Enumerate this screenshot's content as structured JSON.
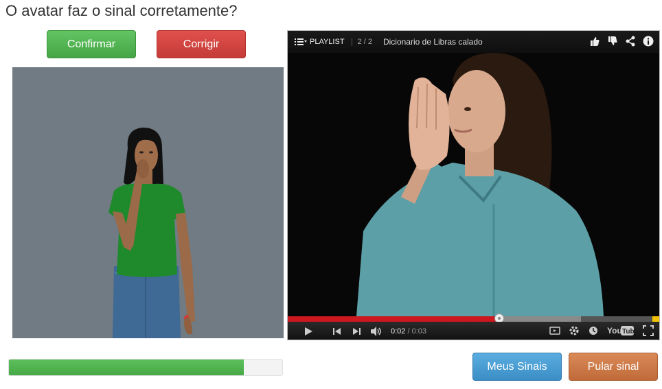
{
  "question": "O avatar faz o sinal corretamente?",
  "buttons": {
    "confirm": "Confirmar",
    "fix": "Corrigir",
    "my_signs": "Meus Sinais",
    "skip": "Pular sinal"
  },
  "video": {
    "playlist_label": "PLAYLIST",
    "playlist_count": "2 / 2",
    "title": "Dicionario de Libras  calado",
    "current_time": "0:02",
    "duration": "/ 0:03",
    "played_fraction": 0.57,
    "buffered_fraction": 0.79
  },
  "progress": {
    "fraction": 0.86
  },
  "colors": {
    "confirm": "#52b452",
    "fix": "#d2453f",
    "my_signs": "#4a9ed5",
    "skip": "#cc7a48",
    "progress": "#52b452",
    "avatar_bg": "#707b83"
  },
  "icons": [
    "playlist-icon",
    "like-icon",
    "dislike-icon",
    "share-icon",
    "info-icon",
    "play-icon",
    "prev-icon",
    "next-icon",
    "volume-icon",
    "subtitles-icon",
    "gear-icon",
    "watch-later-icon",
    "youtube-logo",
    "fullscreen-icon"
  ]
}
